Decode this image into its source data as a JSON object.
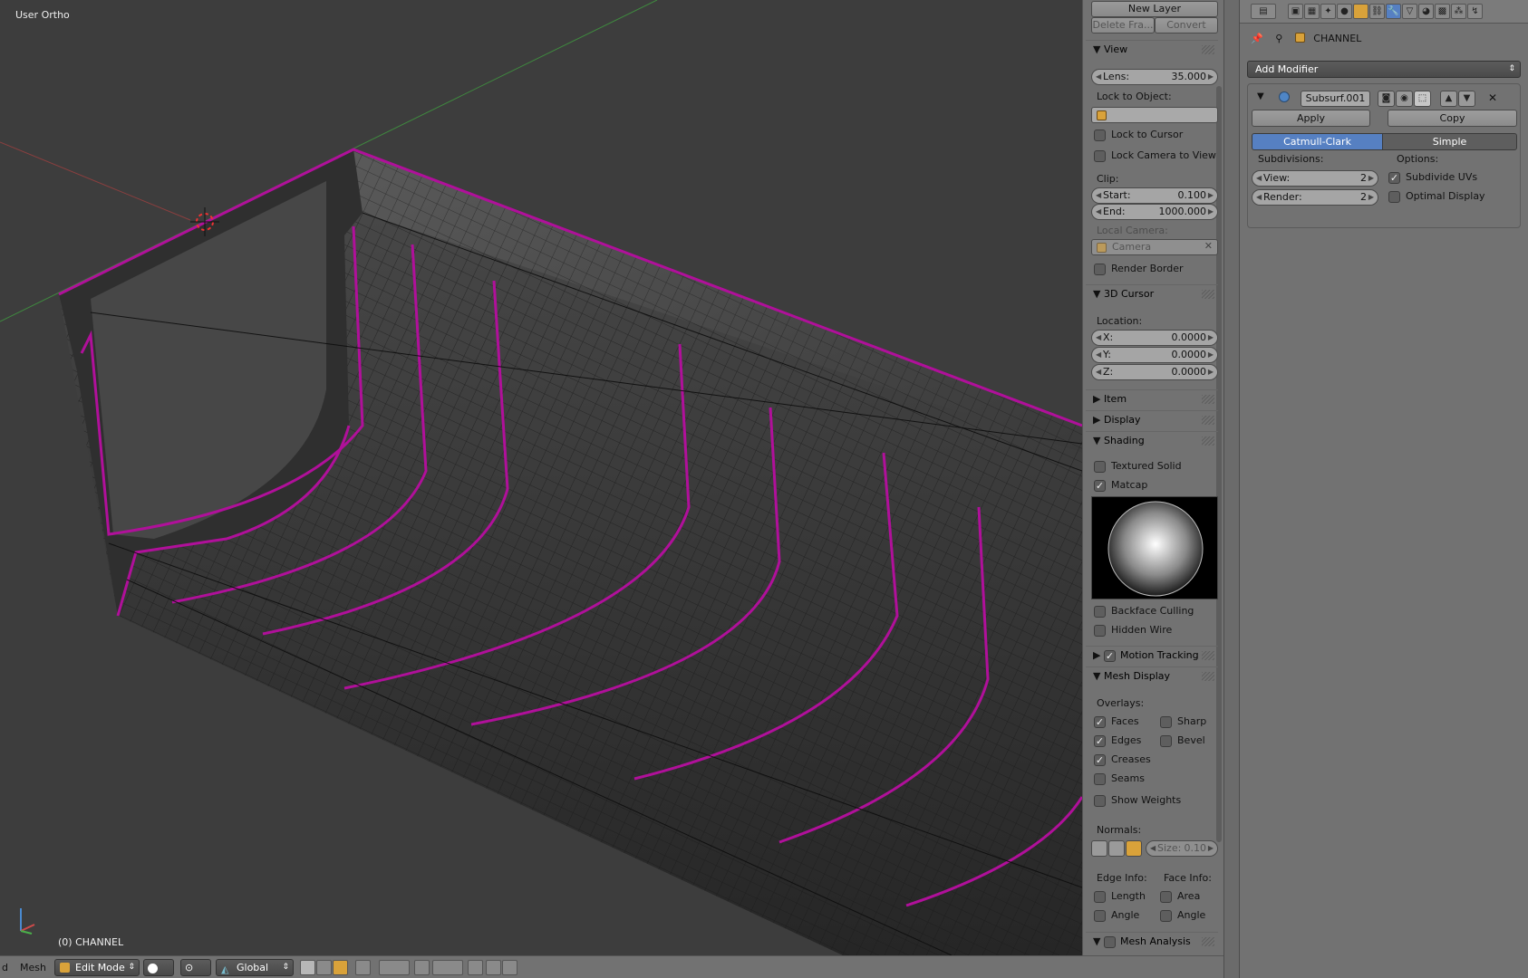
{
  "viewport": {
    "title": "User Ortho",
    "object_label": "(0) CHANNEL"
  },
  "npanel": {
    "top_buttons": {
      "new_layer": "New Layer",
      "delete_frame": "Delete Fra...",
      "convert": "Convert"
    },
    "view": {
      "header": "View",
      "lens_label": "Lens:",
      "lens_value": "35.000",
      "lock_to_object": "Lock to Object:",
      "lock_to_cursor": "Lock to Cursor",
      "lock_camera_to_view": "Lock Camera to View",
      "clip_label": "Clip:",
      "clip_start_label": "Start:",
      "clip_start_value": "0.100",
      "clip_end_label": "End:",
      "clip_end_value": "1000.000",
      "local_camera": "Local Camera:",
      "camera_value": "Camera",
      "render_border": "Render Border"
    },
    "cursor": {
      "header": "3D Cursor",
      "location": "Location:",
      "x_label": "X:",
      "x_value": "0.0000",
      "y_label": "Y:",
      "y_value": "0.0000",
      "z_label": "Z:",
      "z_value": "0.0000"
    },
    "item_header": "Item",
    "display_header": "Display",
    "shading": {
      "header": "Shading",
      "textured_solid": "Textured Solid",
      "matcap": "Matcap",
      "backface_culling": "Backface Culling",
      "hidden_wire": "Hidden Wire"
    },
    "motion_tracking": "Motion Tracking",
    "mesh_display": {
      "header": "Mesh Display",
      "overlays": "Overlays:",
      "faces": "Faces",
      "sharp": "Sharp",
      "edges": "Edges",
      "bevel": "Bevel",
      "creases": "Creases",
      "seams": "Seams",
      "show_weights": "Show Weights",
      "normals": "Normals:",
      "size_label": "Size:",
      "size_value": "0.10",
      "edge_info": "Edge Info:",
      "face_info": "Face Info:",
      "length": "Length",
      "area": "Area",
      "angle_edge": "Angle",
      "angle_face": "Angle"
    },
    "mesh_analysis": "Mesh Analysis"
  },
  "props": {
    "object_name": "CHANNEL",
    "add_modifier": "Add Modifier",
    "modifier": {
      "name": "Subsurf.001",
      "apply": "Apply",
      "copy": "Copy",
      "catmull_clark": "Catmull-Clark",
      "simple": "Simple",
      "subdivisions": "Subdivisions:",
      "options": "Options:",
      "view_label": "View:",
      "view_value": "2",
      "render_label": "Render:",
      "render_value": "2",
      "subdivide_uvs": "Subdivide UVs",
      "optimal_display": "Optimal Display"
    }
  },
  "bottombar": {
    "view_menu": "d",
    "mesh_menu": "Mesh",
    "mode": "Edit Mode",
    "orientation": "Global"
  },
  "colors": {
    "accent": "#5680c2",
    "selection_outline": "#b0109a",
    "mesh_wire": "#111111"
  }
}
